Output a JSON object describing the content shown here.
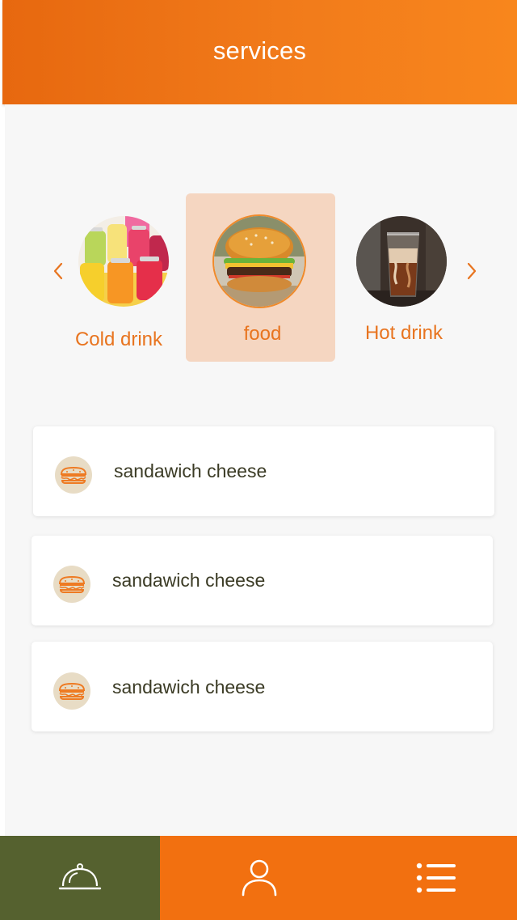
{
  "header": {
    "title": "services"
  },
  "colors": {
    "accent": "#f27c1b",
    "selected_bg": "#f5d6c1",
    "nav_active": "#55612f",
    "text_dark": "#3b3b25"
  },
  "categories": [
    {
      "label": "Cold drink",
      "image": "cold-drink-photo",
      "selected": false
    },
    {
      "label": "food",
      "image": "burger-photo",
      "selected": true
    },
    {
      "label": "Hot drink",
      "image": "iced-coffee-photo",
      "selected": false
    }
  ],
  "items": [
    {
      "label": "sandawich cheese",
      "icon": "sandwich-icon"
    },
    {
      "label": "sandawich cheese",
      "icon": "sandwich-icon"
    },
    {
      "label": "sandawich cheese",
      "icon": "sandwich-icon"
    }
  ],
  "bottom_nav": [
    {
      "name": "services",
      "icon": "cloche-icon",
      "active": true
    },
    {
      "name": "profile",
      "icon": "user-icon",
      "active": false
    },
    {
      "name": "menu",
      "icon": "list-icon",
      "active": false
    }
  ]
}
